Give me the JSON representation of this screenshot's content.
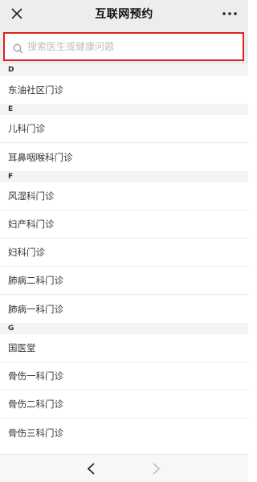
{
  "header": {
    "title": "互联网预约",
    "close_icon": "close-icon",
    "more_icon": "more-dots-icon"
  },
  "search": {
    "placeholder": "搜索医生或健康问题",
    "icon": "search-icon",
    "highlight_color": "#e02020"
  },
  "sections": [
    {
      "letter": "D",
      "items": [
        "东油社区门诊"
      ]
    },
    {
      "letter": "E",
      "items": [
        "儿科门诊",
        "耳鼻咽喉科门诊"
      ]
    },
    {
      "letter": "F",
      "items": [
        "风湿科门诊",
        "妇产科门诊",
        "妇科门诊",
        "肺病二科门诊",
        "肺病一科门诊"
      ]
    },
    {
      "letter": "G",
      "items": [
        "国医堂",
        "骨伤一科门诊",
        "骨伤二科门诊",
        "骨伤三科门诊"
      ]
    }
  ],
  "toolbar": {
    "back_icon": "chevron-left-icon",
    "forward_icon": "chevron-right-icon",
    "back_enabled": true,
    "forward_enabled": false
  }
}
